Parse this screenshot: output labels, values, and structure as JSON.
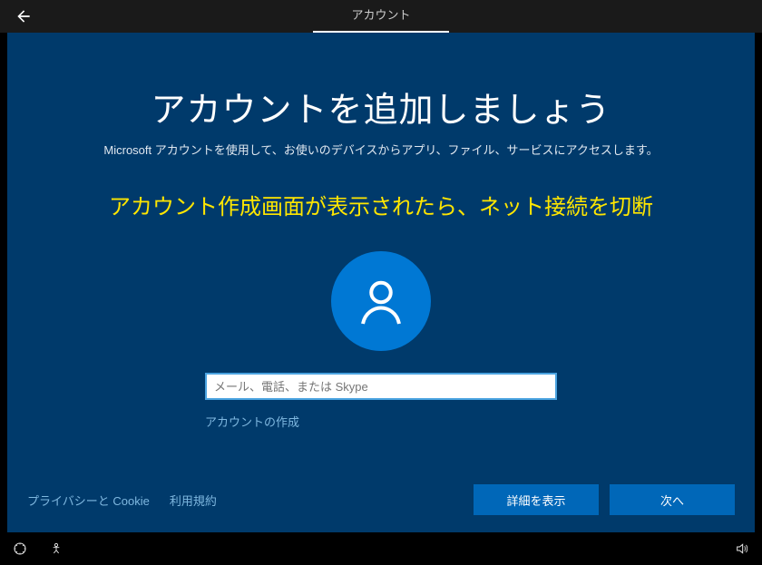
{
  "topbar": {
    "title": "アカウント"
  },
  "heading": "アカウントを追加しましょう",
  "subheading": "Microsoft アカウントを使用して、お使いのデバイスからアプリ、ファイル、サービスにアクセスします。",
  "instruction": "アカウント作成画面が表示されたら、ネット接続を切断",
  "signin": {
    "placeholder": "メール、電話、または Skype",
    "create_link": "アカウントの作成"
  },
  "footer": {
    "privacy": "プライバシーと Cookie",
    "terms": "利用規約",
    "details": "詳細を表示",
    "next": "次へ"
  }
}
